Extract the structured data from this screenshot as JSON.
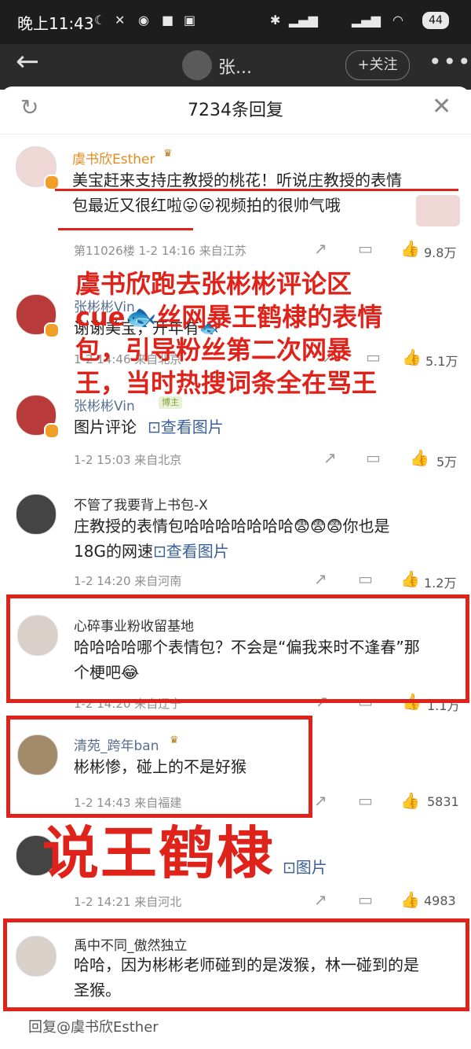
{
  "status_bar": {
    "time": "晚上11:43",
    "battery": "44"
  },
  "header": {
    "user": "张...",
    "follow": "+关注",
    "more": "•••",
    "back": "←"
  },
  "sheet": {
    "title": "7234条回复",
    "refresh": "↻",
    "close": "✕"
  },
  "comments": [
    {
      "name": "虞书欣Esther",
      "text_line1": "美宝赶来支持庄教授的桃花！听说庄教授的表情",
      "text_line2": "包最近又很红啦😛😛视频拍的很帅气哦",
      "meta": "第11026楼 1-2 14:16  来自江苏",
      "likes": "9.8万"
    },
    {
      "name": "张彬彬Vin",
      "text": "谢谢美宝，开年有🐟",
      "meta": "1-2 14:46  来自北京",
      "likes": "5.1万"
    },
    {
      "name": "张彬彬Vin",
      "tag1": "博主",
      "text": "图片评论",
      "link": "查看图片",
      "meta": "1-2 15:03  来自北京",
      "likes": "5万"
    },
    {
      "name": "不管了我要背上书包-X",
      "text_line1": "庄教授的表情包哈哈哈哈哈哈哈😨😨😨你也是",
      "text_line2": "18G的网速",
      "link": "查看图片",
      "meta": "1-2 14:20  来自河南",
      "likes": "1.2万"
    },
    {
      "name": "心碎事业粉收留基地",
      "text_line1": "哈哈哈哈哪个表情包？不会是“偏我来时不逢春”那",
      "text_line2": "个梗吧😂",
      "meta": "1-2 14:20  来自辽宁",
      "likes": "1.1万"
    },
    {
      "name": "清苑_跨年ban",
      "text": "彬彬惨，碰上的不是好猴",
      "meta": "1-2 14:43  来自福建",
      "likes": "5831"
    },
    {
      "link": "图片",
      "meta": "1-2 14:21  来自河北",
      "likes": "4983"
    },
    {
      "name": "禹中不同_傲然独立",
      "text_line1": "哈哈，因为彬彬老师碰到的是泼猴，林一碰到的是",
      "text_line2": "圣猴。"
    }
  ],
  "reply_input": "回复@虞书欣Esther",
  "overlay": {
    "line1": "虞书欣跑去张彬彬评论区",
    "line2": "cue🐟丝网暴王鹤棣的表情",
    "line3": "包，引导粉丝第二次网暴",
    "line4": "王，当时热搜词条全在骂王",
    "big": "说王鹤棣"
  },
  "colors": {
    "accent_red": "#e0231a",
    "link": "#3b5f9a",
    "username": "#5a6f8f"
  }
}
